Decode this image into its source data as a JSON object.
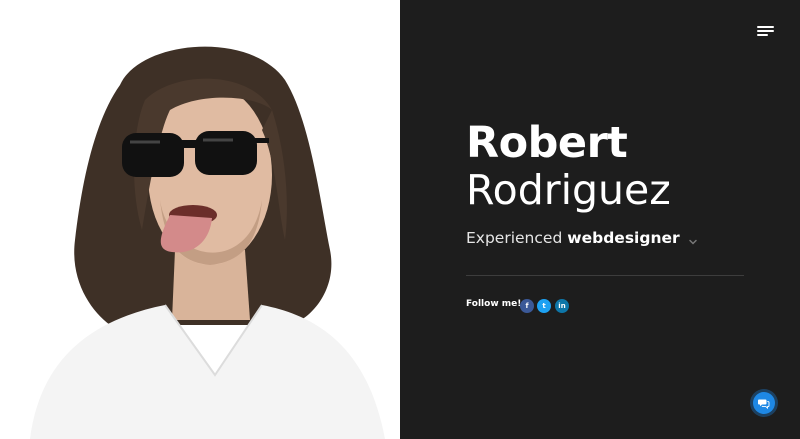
{
  "hero": {
    "first_name": "Robert",
    "last_name": "Rodriguez",
    "role_prefix": "Experienced",
    "role_highlight": "webdesigner"
  },
  "social": {
    "label": "Follow me!",
    "links": [
      {
        "name": "facebook",
        "glyph": "f",
        "color": "#3b5998"
      },
      {
        "name": "twitter",
        "glyph": "t",
        "color": "#1da1f2"
      },
      {
        "name": "linkedin",
        "glyph": "in",
        "color": "#0e76a8"
      }
    ]
  },
  "icons": {
    "menu": "hamburger-menu-icon",
    "role_toggle": "chevron-down-icon",
    "chat": "chat-bubbles-icon"
  },
  "colors": {
    "panel_background": "#1d1d1d",
    "accent": "#1e88e5"
  }
}
